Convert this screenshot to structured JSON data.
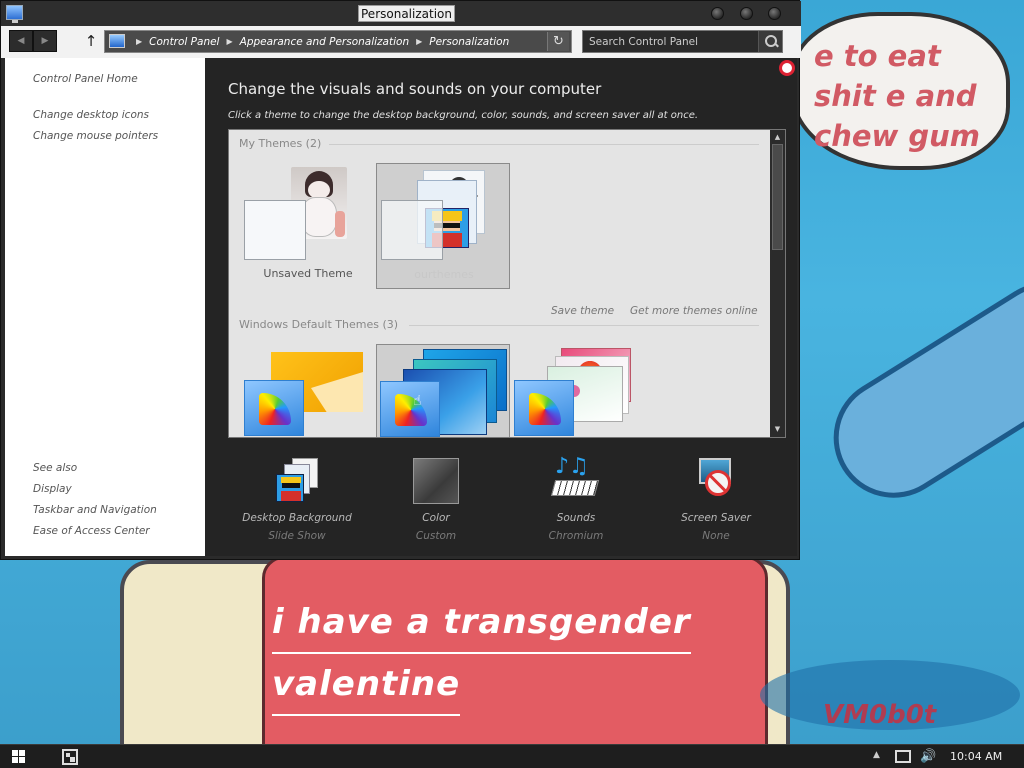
{
  "window": {
    "title": "Personalization",
    "controls": [
      "minimize",
      "maximize",
      "close"
    ]
  },
  "address_bar": {
    "breadcrumb": [
      "Control Panel",
      "Appearance and Personalization",
      "Personalization"
    ],
    "search_placeholder": "Search Control Panel"
  },
  "left_pane": {
    "home": "Control Panel Home",
    "links": [
      "Change desktop icons",
      "Change mouse pointers"
    ],
    "see_also_header": "See also",
    "see_also": [
      "Display",
      "Taskbar and Navigation",
      "Ease of Access Center"
    ]
  },
  "main": {
    "title": "Change the visuals and sounds on your computer",
    "subtitle": "Click a theme to change the desktop background, color, sounds, and screen saver all at once.",
    "my_themes_header": "My Themes (2)",
    "my_themes": [
      {
        "label": "Unsaved Theme",
        "selected": false
      },
      {
        "label": "ourthemes",
        "selected": true
      }
    ],
    "save_theme": "Save theme",
    "get_more_themes": "Get more themes online",
    "default_themes_header": "Windows Default Themes (3)",
    "default_themes": [
      {
        "icon": "windows-theme-thumbnail",
        "selected": false
      },
      {
        "icon": "windows-blue-theme-thumbnail",
        "selected": true
      },
      {
        "icon": "flowers-theme-thumbnail",
        "selected": false
      }
    ],
    "bottom": [
      {
        "label": "Desktop Background",
        "value": "Slide Show",
        "icon": "desktop-background-icon"
      },
      {
        "label": "Color",
        "value": "Custom",
        "icon": "color-icon"
      },
      {
        "label": "Sounds",
        "value": "Chromium",
        "icon": "sounds-icon"
      },
      {
        "label": "Screen Saver",
        "value": "None",
        "icon": "screen-saver-icon"
      }
    ]
  },
  "wallpaper": {
    "bubble_text": "e to eat shit e and chew gum",
    "heart_line1": "i have a transgender",
    "heart_line2": "valentine",
    "signature": "VM0b0t"
  },
  "taskbar": {
    "clock": "10:04 AM"
  },
  "colors": {
    "window_dark": "#2b2b2b",
    "left_pane": "#ffffff",
    "theme_panel": "#e4e4e4",
    "accent_blue": "#2f85dc"
  }
}
